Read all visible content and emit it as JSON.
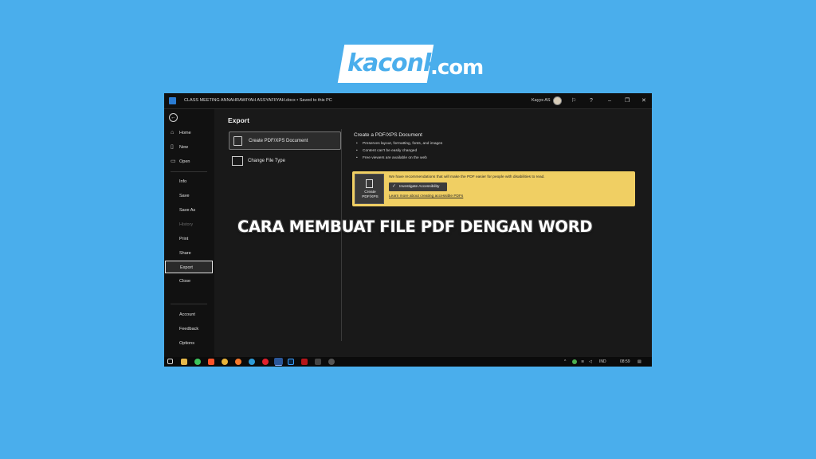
{
  "logo": {
    "brand": "kaconk",
    "tld": ".com"
  },
  "headline": "CARA MEMBUAT FILE PDF DENGAN WORD",
  "titlebar": {
    "document": "CLASS MEETING ANNAHRAWIYAH ASSYAFIIYAH.docx • Saved to this PC",
    "user": "Kayys AS",
    "icons": [
      "word-icon",
      "feedback-icon",
      "help-icon",
      "minimize-icon",
      "restore-icon",
      "close-icon"
    ]
  },
  "nav": {
    "back_icon": "back-arrow-icon",
    "items": [
      {
        "label": "Home",
        "icon": "home-icon"
      },
      {
        "label": "New",
        "icon": "new-doc-icon"
      },
      {
        "label": "Open",
        "icon": "folder-icon"
      },
      {
        "label": "Info"
      },
      {
        "label": "Save"
      },
      {
        "label": "Save As"
      },
      {
        "label": "History"
      },
      {
        "label": "Print"
      },
      {
        "label": "Share"
      },
      {
        "label": "Export"
      },
      {
        "label": "Close"
      }
    ],
    "bottom": [
      {
        "label": "Account"
      },
      {
        "label": "Feedback"
      },
      {
        "label": "Options"
      }
    ],
    "selected": "Export",
    "disabled": "History"
  },
  "export": {
    "title": "Export",
    "options": [
      {
        "label": "Create PDF/XPS Document",
        "icon": "pdf-doc-icon"
      },
      {
        "label": "Change File Type",
        "icon": "file-type-icon"
      }
    ],
    "detail_title": "Create a PDF/XPS Document",
    "bullets": [
      "Preserves layout, formatting, fonts, and images",
      "Content can't be easily changed",
      "Free viewers are available on the web"
    ],
    "callout": {
      "button_label": "Create\nPDF/XPS",
      "text": "We have recommendations that will make the PDF easier for people with disabilities to read.",
      "investigate_label": "Investigate Accessibility",
      "learn_link": "Learn more about creating accessible PDFs",
      "color": "#f0cf63"
    }
  },
  "taskbar": {
    "lang": "IND",
    "time": "08:59",
    "apps": [
      "start-icon",
      "file-explorer-icon",
      "whatsapp-icon",
      "brave-icon",
      "chrome-icon",
      "firefox-icon",
      "edge-icon",
      "opera-icon",
      "word-taskbar-icon",
      "photoshop-icon",
      "acrobat-icon",
      "media-icon",
      "obs-icon"
    ]
  }
}
